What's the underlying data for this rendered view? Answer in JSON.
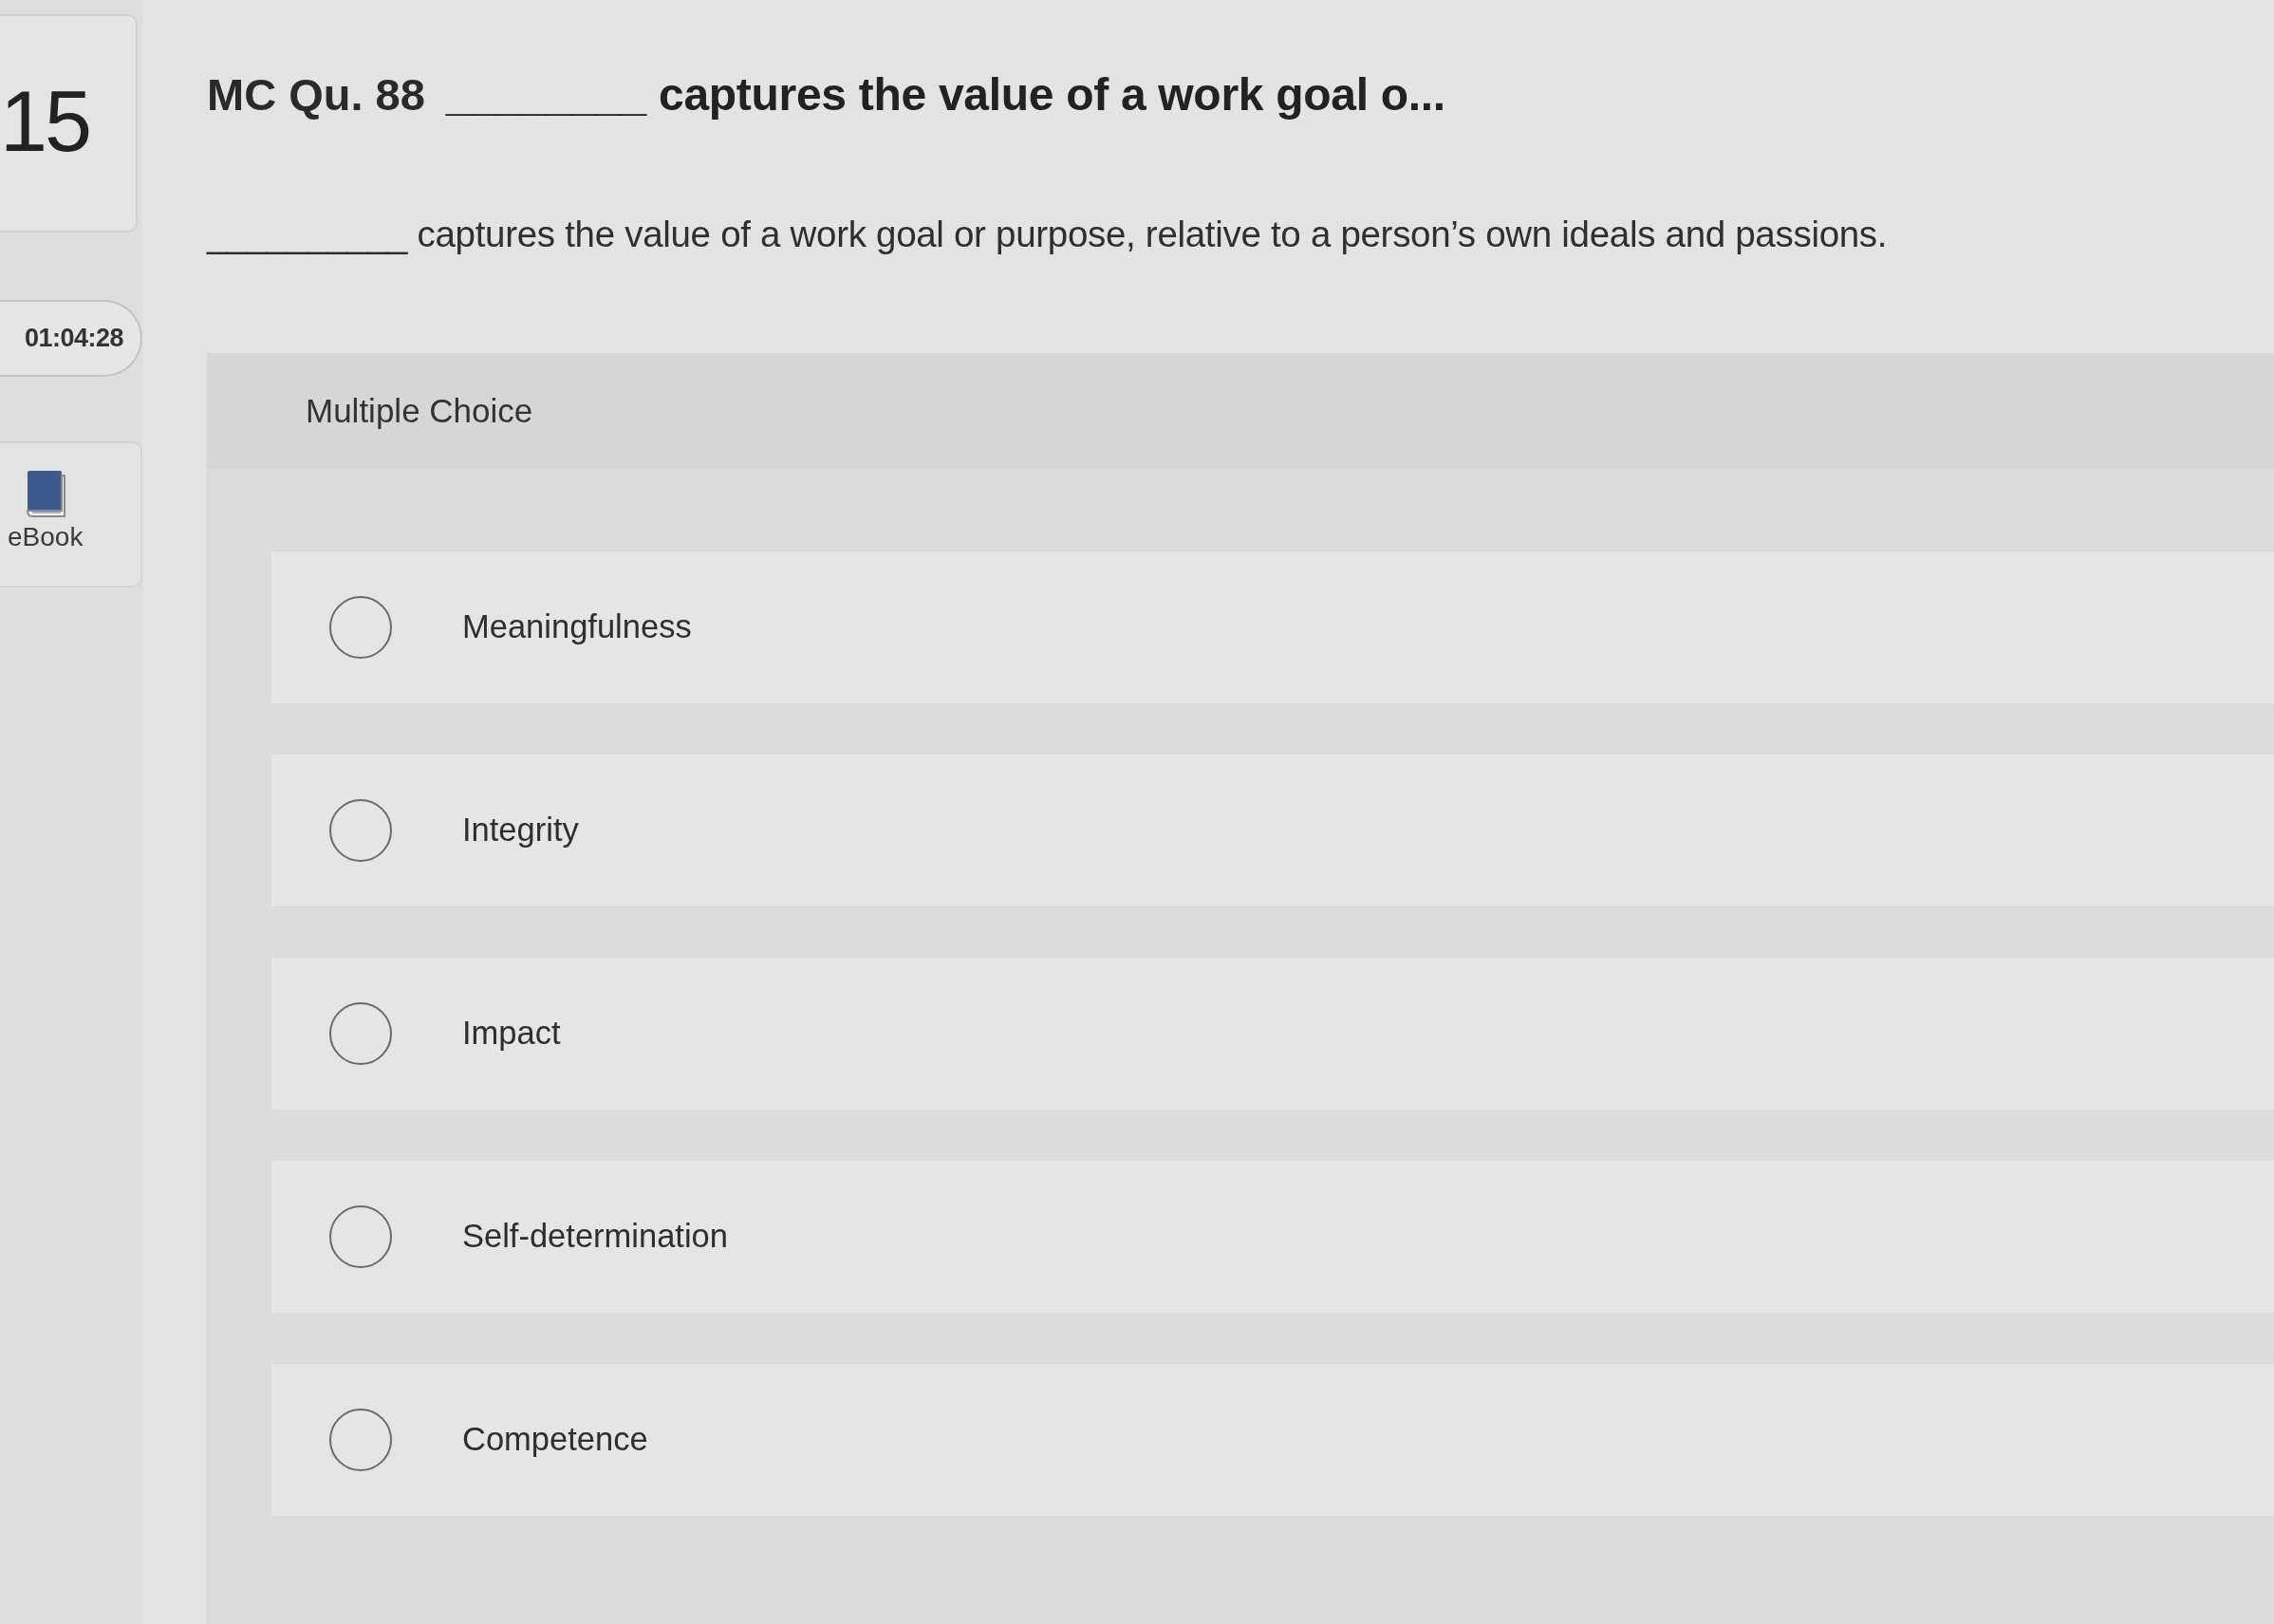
{
  "question_number": "15",
  "timer": "01:04:28",
  "ebook": {
    "label": "eBook"
  },
  "header": {
    "prefix": "MC Qu. 88",
    "title": "________ captures the value of a work goal o..."
  },
  "question": {
    "text": "__________ captures the value of a work goal or purpose, relative to a person’s own ideals and passions."
  },
  "answer_type": "Multiple Choice",
  "options": [
    {
      "label": "Meaningfulness",
      "selected": false
    },
    {
      "label": "Integrity",
      "selected": false
    },
    {
      "label": "Impact",
      "selected": false
    },
    {
      "label": "Self-determination",
      "selected": false
    },
    {
      "label": "Competence",
      "selected": false
    }
  ]
}
